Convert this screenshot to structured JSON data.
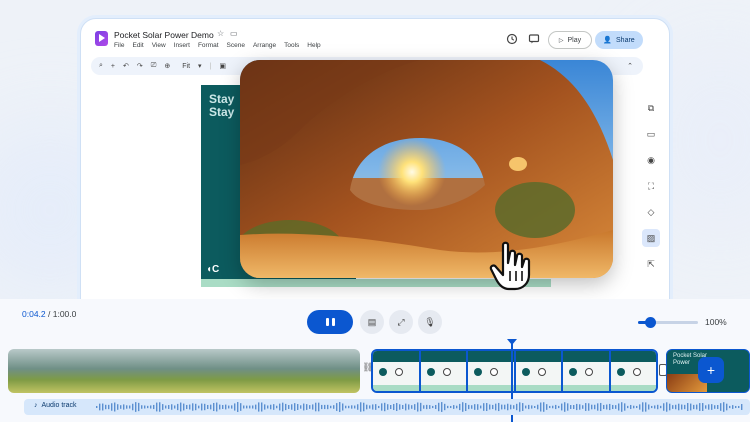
{
  "app": {
    "doc_title": "Pocket Solar Power Demo",
    "menu": [
      "File",
      "Edit",
      "View",
      "Insert",
      "Format",
      "Scene",
      "Arrange",
      "Tools",
      "Help"
    ],
    "play_label": "Play",
    "share_label": "Share",
    "zoom_label": "Fit"
  },
  "slide": {
    "text": "Stay\nStay"
  },
  "timeline": {
    "current_time": "0:04.2",
    "total_time": " / 1:00.0",
    "zoom_percent": "100%",
    "zoom_level": 0.2,
    "audio_label": "Audio track",
    "poster_clip_title": "Pocket Solar\nPower"
  },
  "colors": {
    "accent": "#0b57d0",
    "slide_teal": "#0c5b5e",
    "share_bg": "#c2dcfb"
  }
}
